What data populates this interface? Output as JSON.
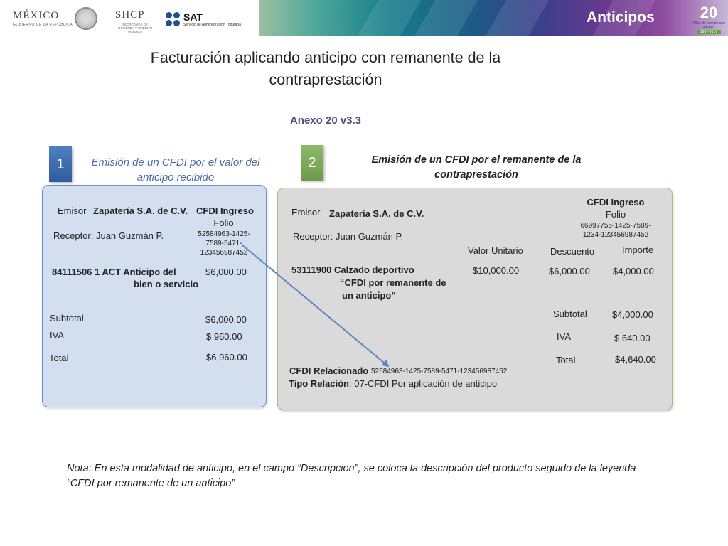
{
  "header": {
    "logo_mexico": "MÉXICO",
    "logo_mexico_sub": "GOBIERNO DE LA REPÚBLICA",
    "logo_shcp": "SHCP",
    "logo_shcp_sub": "SECRETARÍA DE HACIENDA Y CRÉDITO PÚBLICO",
    "logo_sat": "SAT",
    "logo_sat_sub": "Servicio de Administración Tributaria",
    "section_title": "Anticipos",
    "badge_number": "20",
    "badge_sub": "Años de cumplir con México",
    "badge_years": "1997-2017",
    "banner_colors": [
      "#9cc0a0",
      "#167d8a",
      "#3b3f8c",
      "#8d4aa0"
    ]
  },
  "title_line1": "Facturación aplicando anticipo con remanente de la",
  "title_line2": "contraprestación",
  "annex": "Anexo 20 v3.3",
  "step1": {
    "number": "1",
    "caption_line1": "Emisión de un CFDI por el valor del",
    "caption_line2": "anticipo recibido",
    "emisor_label": "Emisor",
    "emisor_name": "Zapatería S.A. de C.V.",
    "cfdi_type": "CFDI Ingreso",
    "folio_label": "Folio",
    "folio_line1": "52584963-1425-",
    "folio_line2": "7589-5471-",
    "folio_line3": "123456987452",
    "receptor": "Receptor: Juan Guzmán P.",
    "concept_line1": "84111506  1  ACT  Anticipo  del",
    "concept_line2": "bien o servicio",
    "concept_amount": "$6,000.00",
    "subtotal_label": "Subtotal",
    "subtotal": "$6,000.00",
    "iva_label": "IVA",
    "iva": "$  960.00",
    "total_label": "Total",
    "total": "$6,960.00"
  },
  "step2": {
    "number": "2",
    "caption_line1": "Emisión de un CFDI por el remanente de la",
    "caption_line2": "contraprestación",
    "cfdi_type": "CFDI Ingreso",
    "folio_label": "Folio",
    "folio_line1": "66997755-1425-7589-",
    "folio_line2": "1234-123456987452",
    "emisor_label": "Emisor",
    "emisor_name": "Zapatería S.A. de C.V.",
    "receptor": "Receptor: Juan Guzmán P.",
    "col_unit": "Valor Unitario",
    "col_discount": "Descuento",
    "col_amount": "Importe",
    "concept_line1": "53111900   Calzado deportivo",
    "concept_line2": "“CFDI  por remanente de",
    "concept_line3": "un anticipo”",
    "unit_value": "$10,000.00",
    "discount": "$6,000.00",
    "amount": "$4,000.00",
    "subtotal_label": "Subtotal",
    "subtotal": "$4,000.00",
    "iva_label": "IVA",
    "iva": "$  640.00",
    "total_label": "Total",
    "total": "$4,640.00",
    "related_label": "CFDI Relacionado",
    "related_uuid": "52584963-1425-7589-5471-123456987452",
    "relation_label": "Tipo Relación",
    "relation_value": ": 07-CFDI Por aplicación de  anticipo"
  },
  "note_line1": "Nota: En esta modalidad de anticipo, en el campo “Descripcion”, se coloca la descripción del producto seguido de la leyenda",
  "note_line2": "“CFDI  por remanente de un anticipo”",
  "colors": {
    "arrow": "#5b86c4",
    "box1_fill": "#d3deee",
    "box2_fill": "#d9dad9",
    "accent_purple": "#5a4a82",
    "caption_blue": "#4a6fa3"
  }
}
